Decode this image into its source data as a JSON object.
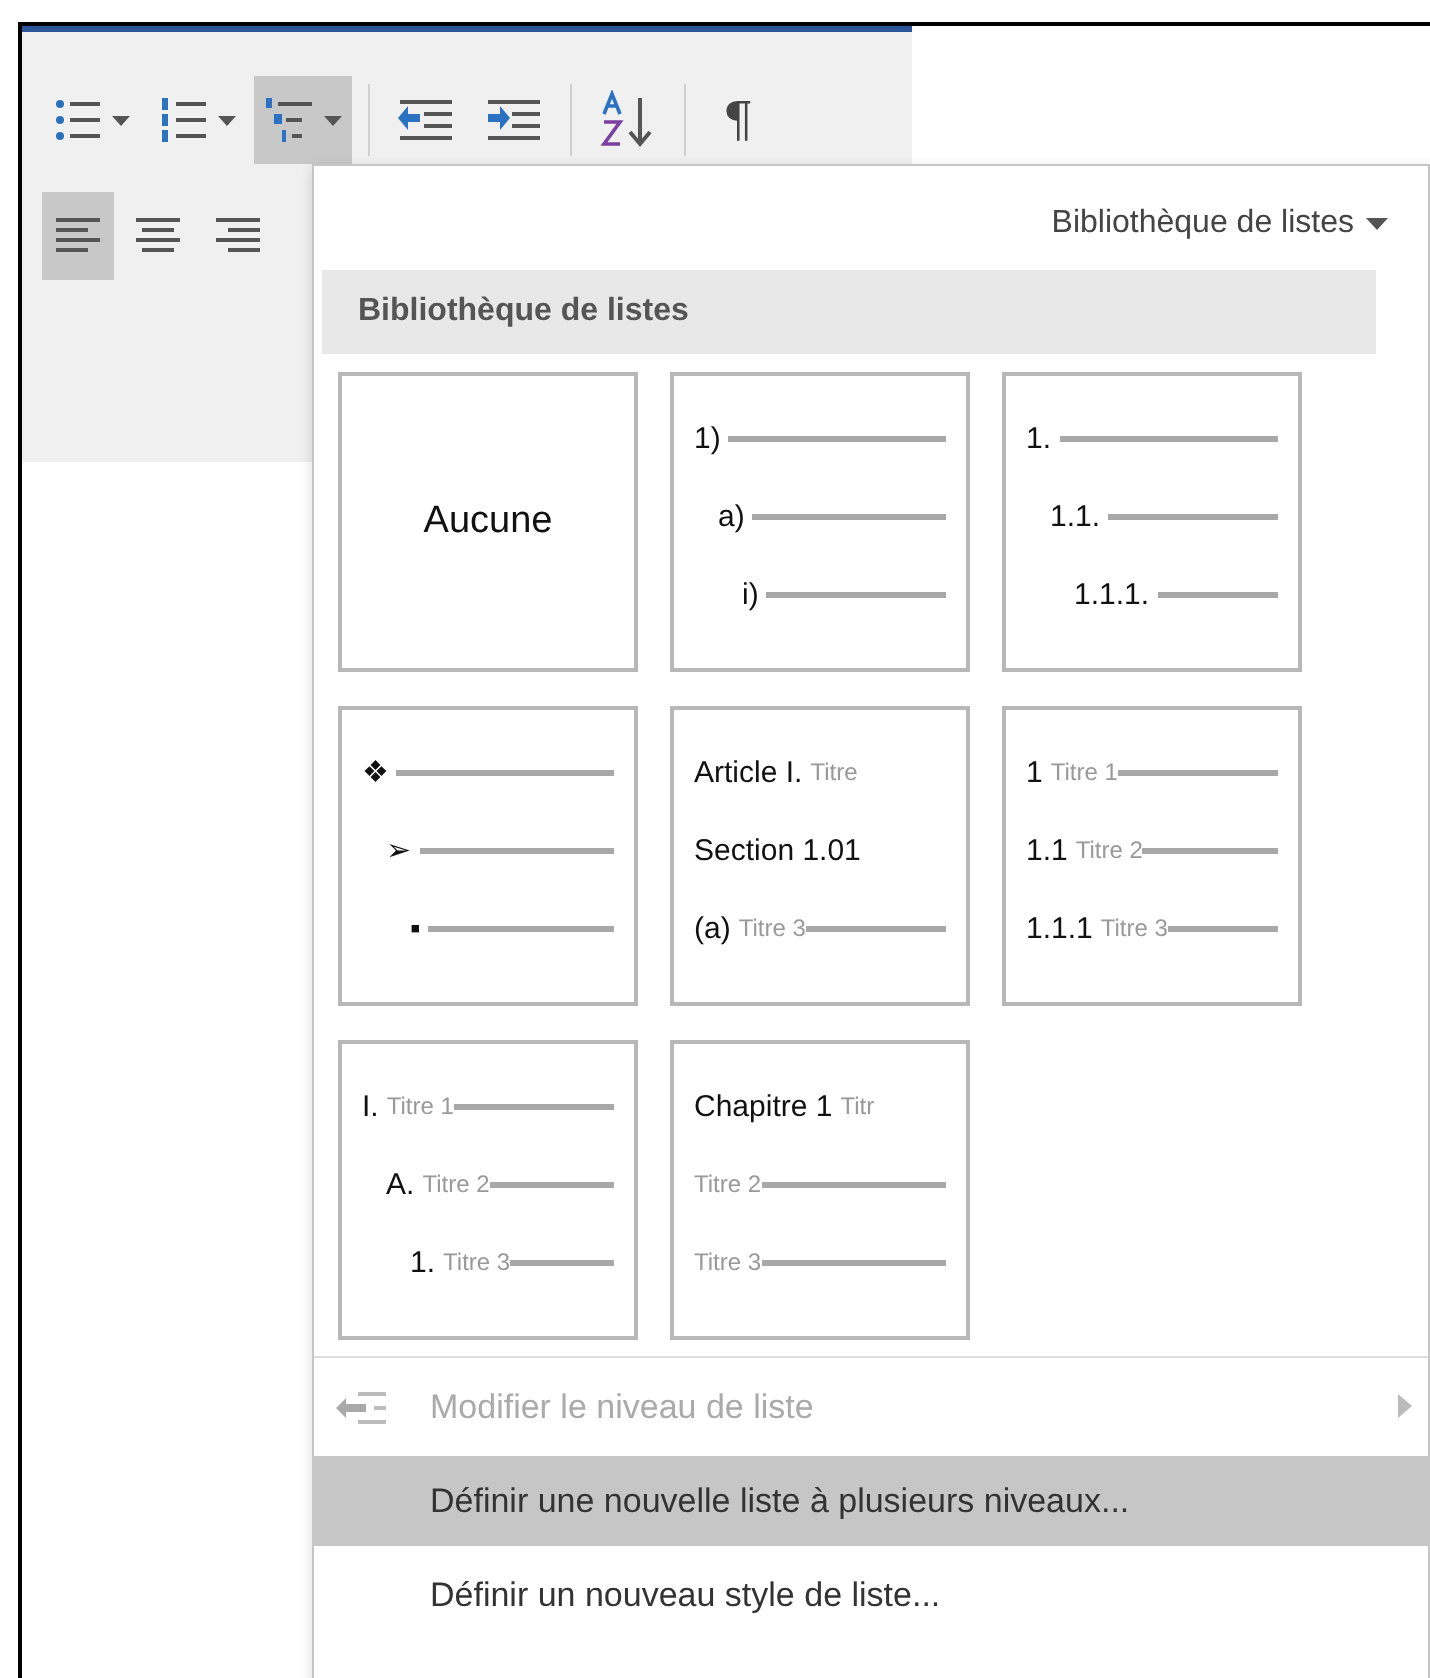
{
  "toolbar": {
    "rows": [
      [
        {
          "kind": "bullets",
          "dropdown": true,
          "selected": false
        },
        {
          "kind": "numbering",
          "dropdown": true,
          "selected": false
        },
        {
          "kind": "multilevel",
          "dropdown": true,
          "selected": true
        },
        {
          "kind": "separator"
        },
        {
          "kind": "outdent",
          "dropdown": false,
          "selected": false
        },
        {
          "kind": "indent",
          "dropdown": false,
          "selected": false
        },
        {
          "kind": "separator"
        },
        {
          "kind": "sort",
          "dropdown": false,
          "selected": false
        },
        {
          "kind": "separator"
        },
        {
          "kind": "pilcrow",
          "glyph": "¶",
          "dropdown": false,
          "selected": false
        }
      ],
      [
        {
          "kind": "align-left",
          "dropdown": false,
          "selected": true
        },
        {
          "kind": "align-center",
          "dropdown": false,
          "selected": false
        },
        {
          "kind": "align-right",
          "dropdown": false,
          "selected": false
        }
      ]
    ]
  },
  "menu": {
    "gallery_button": "Bibliothèque de listes",
    "section_title": "Bibliothèque de listes",
    "tiles": [
      {
        "kind": "none",
        "label": "Aucune"
      },
      {
        "kind": "levels",
        "indented": true,
        "lines": [
          {
            "marker": "1)",
            "rule": true
          },
          {
            "marker": "a)",
            "rule": true
          },
          {
            "marker": "i)",
            "rule": true
          }
        ]
      },
      {
        "kind": "levels",
        "indented": true,
        "lines": [
          {
            "marker": "1.",
            "rule": true
          },
          {
            "marker": "1.1.",
            "rule": true
          },
          {
            "marker": "1.1.1.",
            "rule": true
          }
        ]
      },
      {
        "kind": "levels",
        "indented": true,
        "lines": [
          {
            "marker": "❖",
            "rule": true
          },
          {
            "marker": "➢",
            "rule": true
          },
          {
            "marker": "▪",
            "rule": true
          }
        ]
      },
      {
        "kind": "levels",
        "indented": false,
        "lines": [
          {
            "marker": "Article I.",
            "text": "Titre",
            "rule": false
          },
          {
            "marker": "Section 1.01",
            "rule": false
          },
          {
            "marker": "(a)",
            "text": "Titre 3",
            "rule": true
          }
        ]
      },
      {
        "kind": "levels",
        "indented": false,
        "lines": [
          {
            "marker": "1",
            "text": "Titre 1",
            "rule": true
          },
          {
            "marker": "1.1",
            "text": "Titre 2",
            "rule": true
          },
          {
            "marker": "1.1.1",
            "text": "Titre 3",
            "rule": true
          }
        ]
      },
      {
        "kind": "levels",
        "indented": true,
        "lines": [
          {
            "marker": "I.",
            "text": "Titre 1",
            "rule": true
          },
          {
            "marker": "A.",
            "text": "Titre 2",
            "rule": true
          },
          {
            "marker": "1.",
            "text": "Titre 3",
            "rule": true
          }
        ]
      },
      {
        "kind": "levels",
        "indented": false,
        "lines": [
          {
            "marker": "Chapitre 1",
            "text": "Titr",
            "rule": false
          },
          {
            "text": "Titre 2",
            "rule": true
          },
          {
            "text": "Titre 3",
            "rule": true
          }
        ]
      }
    ],
    "items": [
      {
        "label": "Modifier le niveau de liste",
        "icon": true,
        "submenu": true,
        "disabled": true,
        "selected": false
      },
      {
        "label": "Définir une nouvelle liste à plusieurs niveaux...",
        "icon": false,
        "submenu": false,
        "disabled": false,
        "selected": true
      },
      {
        "label": "Définir un nouveau style de liste...",
        "icon": false,
        "submenu": false,
        "disabled": false,
        "selected": false
      }
    ]
  }
}
